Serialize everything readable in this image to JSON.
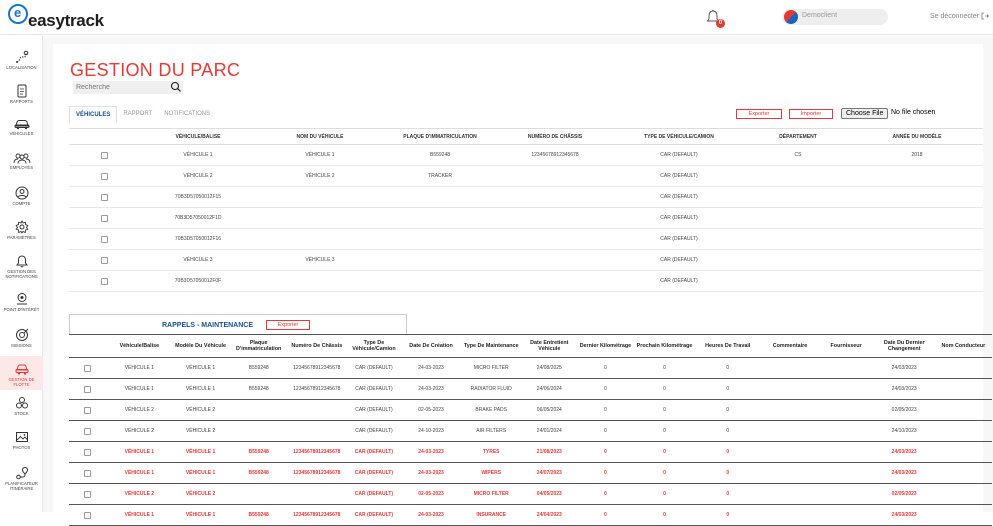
{
  "header": {
    "logo_text": "easytrack",
    "notification_count": "0",
    "user_name": "Democlient",
    "logout_label": "Se déconnecter"
  },
  "sidebar": {
    "items": [
      {
        "label": "LOCALISATION",
        "icon": "location-route-icon"
      },
      {
        "label": "RAPPORTS",
        "icon": "report-icon"
      },
      {
        "label": "VÉHICULES",
        "icon": "car-icon"
      },
      {
        "label": "EMPLOYÉS",
        "icon": "employees-icon"
      },
      {
        "label": "COMPTE",
        "icon": "account-icon"
      },
      {
        "label": "PARAMÈTRES",
        "icon": "gear-icon"
      },
      {
        "label": "GESTION DES NOTIFICATIONS",
        "icon": "bell-icon"
      },
      {
        "label": "POINT D'INTÉRÊT",
        "icon": "poi-icon"
      },
      {
        "label": "MISSIONS",
        "icon": "missions-icon"
      },
      {
        "label": "GESTION DE FLOTTE",
        "icon": "fleet-icon",
        "active": true
      },
      {
        "label": "STOCK",
        "icon": "stock-icon"
      },
      {
        "label": "PHOTOS",
        "icon": "photos-icon"
      },
      {
        "label": "PLANIFICATEUR ITINÉRAIRE",
        "icon": "route-planner-icon"
      }
    ]
  },
  "page": {
    "title": "GESTION DU PARC",
    "search_placeholder": "Recherche",
    "tabs": [
      "VÉHICULES",
      "RAPPORT",
      "NOTIFICATIONS"
    ],
    "export_label": "Exporter",
    "import_label": "Importer",
    "file_button_label": "Choose File",
    "file_status": "No file chosen"
  },
  "vehicles_table": {
    "columns": [
      "VÉHICULE/BALISE",
      "NOM DU VÉHICULE",
      "PLAQUE D'IMMATRICULATION",
      "NUMÉRO DE CHÂSSIS",
      "TYPE DE VÉHICULE/CAMION",
      "DÉPARTEMENT",
      "ANNÉE DU MODÈLE"
    ],
    "rows": [
      [
        "VÉHICULE 1",
        "VÉHICULE 1",
        "B559248",
        "12345678912345678",
        "CAR (DEFAULT)",
        "CS",
        "2018"
      ],
      [
        "VÉHICULE 2",
        "VÉHICULE 2",
        "TRACKER",
        "",
        "CAR (DEFAULT)",
        "",
        ""
      ],
      [
        "70B3D57050012F15",
        "",
        "",
        "",
        "CAR (DEFAULT)",
        "",
        ""
      ],
      [
        "70B3D57050012F1D",
        "",
        "",
        "",
        "CAR (DEFAULT)",
        "",
        ""
      ],
      [
        "70B3D57050012F16",
        "",
        "",
        "",
        "CAR (DEFAULT)",
        "",
        ""
      ],
      [
        "VÉHICULE 3",
        "VÉHICULE 3",
        "",
        "",
        "CAR (DEFAULT)",
        "",
        ""
      ],
      [
        "70B3D57050012F0F",
        "",
        "",
        "",
        "CAR (DEFAULT)",
        "",
        ""
      ]
    ]
  },
  "maintenance": {
    "title": "RAPPELS - MAINTENANCE",
    "export_label": "Exporter",
    "columns": [
      "Véhicule/Balise",
      "Modèle Du Véhicule",
      "Plaque D'immatriculation",
      "Numéro De Châssis",
      "Type De Véhicule/Camion",
      "Date De Création",
      "Type De Maintenance",
      "Date Entretient Véhicule",
      "Dernier Kilométrage",
      "Prochain Kilométrage",
      "Heures De Travail",
      "Commentaire",
      "Fournisseur",
      "Date Du Dernier Changement",
      "Nom Conducteur"
    ],
    "rows": [
      {
        "alert": false,
        "cells": [
          "VÉHICULE 1",
          "VÉHICULE 1",
          "B559248",
          "12345678912345678",
          "CAR (DEFAULT)",
          "24-03-2023",
          "MICRO FILTER",
          "24/08/2025",
          "0",
          "0",
          "0",
          "",
          "",
          "24/03/2023",
          ""
        ]
      },
      {
        "alert": false,
        "cells": [
          "VÉHICULE 1",
          "VÉHICULE 1",
          "B559248",
          "12345678912345678",
          "CAR (DEFAULT)",
          "24-03-2023",
          "RADIATOR FLUID",
          "24/06/2024",
          "0",
          "0",
          "0",
          "",
          "",
          "24/03/2023",
          ""
        ]
      },
      {
        "alert": false,
        "cells": [
          "VÉHICULE 2",
          "VÉHICULE 2",
          "",
          "",
          "CAR (DEFAULT)",
          "02-05-2023",
          "BRAKE PADS",
          "06/05/2024",
          "0",
          "0",
          "0",
          "",
          "",
          "02/05/2023",
          ""
        ]
      },
      {
        "alert": false,
        "cells": [
          "VÉHICULE 2",
          "VÉHICULE 2",
          "",
          "",
          "CAR (DEFAULT)",
          "24-10-2023",
          "AIR FILTERS",
          "24/01/2024",
          "0",
          "0",
          "0",
          "",
          "",
          "24/10/2023",
          ""
        ]
      },
      {
        "alert": true,
        "cells": [
          "VÉHICULE 1",
          "VÉHICULE 1",
          "B559248",
          "12345678912345678",
          "CAR (DEFAULT)",
          "24-03-2023",
          "TYRES",
          "21/08/2023",
          "0",
          "0",
          "0",
          "",
          "",
          "24/03/2023",
          ""
        ]
      },
      {
        "alert": true,
        "cells": [
          "VÉHICULE 1",
          "VÉHICULE 1",
          "B559248",
          "12345678912345678",
          "CAR (DEFAULT)",
          "24-03-2023",
          "WIPERS",
          "24/07/2023",
          "0",
          "0",
          "0",
          "",
          "",
          "24/03/2023",
          ""
        ]
      },
      {
        "alert": true,
        "cells": [
          "VÉHICULE 2",
          "VÉHICULE 2",
          "",
          "",
          "CAR (DEFAULT)",
          "02-05-2023",
          "MICRO FILTER",
          "04/05/2023",
          "0",
          "0",
          "0",
          "",
          "",
          "02/05/2023",
          ""
        ]
      },
      {
        "alert": true,
        "cells": [
          "VÉHICULE 1",
          "VÉHICULE 1",
          "B559248",
          "12345678912345678",
          "CAR (DEFAULT)",
          "24-03-2023",
          "INSURANCE",
          "24/04/2023",
          "0",
          "0",
          "0",
          "",
          "",
          "24/03/2023",
          ""
        ]
      }
    ]
  },
  "colors": {
    "accent": "#e53935",
    "brand_blue": "#1a4f8a"
  }
}
